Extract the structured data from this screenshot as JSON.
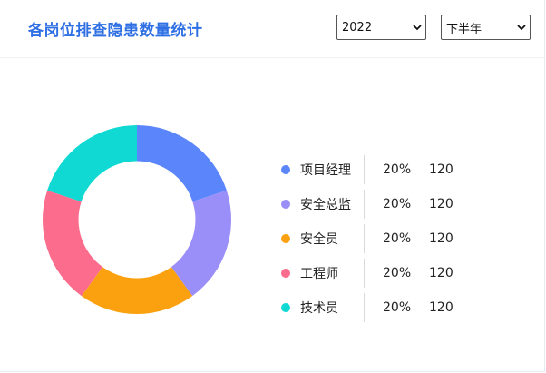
{
  "header": {
    "title": "各岗位排查隐患数量统计",
    "year_select": {
      "value": "2022"
    },
    "half_select": {
      "value": "下半年"
    }
  },
  "chart_data": {
    "type": "pie",
    "inner_radius_ratio": 0.62,
    "slices": [
      {
        "label": "项目经理",
        "percent": "20%",
        "value": 120,
        "color": "#5b86fb"
      },
      {
        "label": "安全总监",
        "percent": "20%",
        "value": 120,
        "color": "#9a8ff8"
      },
      {
        "label": "安全员",
        "percent": "20%",
        "value": 120,
        "color": "#fba00f"
      },
      {
        "label": "工程师",
        "percent": "20%",
        "value": 120,
        "color": "#fb6c8d"
      },
      {
        "label": "技术员",
        "percent": "20%",
        "value": 120,
        "color": "#0fd9d2"
      }
    ],
    "legend_position": "right"
  },
  "icons": {
    "select_arrow": "chevron-down-icon"
  }
}
